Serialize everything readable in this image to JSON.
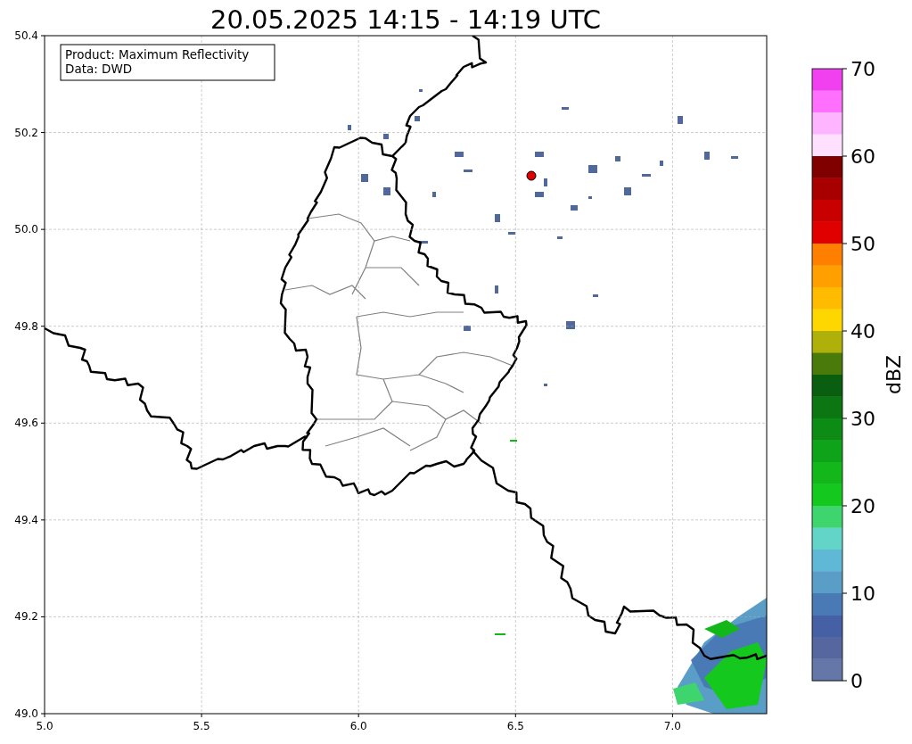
{
  "title": "20.05.2025 14:15 - 14:19 UTC",
  "map": {
    "xticks": [
      "5.0",
      "5.5",
      "6.0",
      "6.5",
      "7.0"
    ],
    "yticks": [
      "50.4",
      "50.2",
      "50.0",
      "49.8",
      "49.6",
      "49.4",
      "49.2",
      "49.0"
    ],
    "legend": [
      "Product: Maximum Reflectivity",
      "Data: DWD"
    ]
  },
  "colorbar": {
    "label": "dBZ",
    "ticks": [
      "70",
      "60",
      "50",
      "40",
      "30",
      "20",
      "10",
      "0"
    ],
    "segments": [
      {
        "color": "#f040f0"
      },
      {
        "color": "#ff70ff"
      },
      {
        "color": "#ffb4ff"
      },
      {
        "color": "#ffe0ff"
      },
      {
        "color": "#800000"
      },
      {
        "color": "#a80000"
      },
      {
        "color": "#c80000"
      },
      {
        "color": "#e00000"
      },
      {
        "color": "#ff7f00"
      },
      {
        "color": "#ffa000"
      },
      {
        "color": "#ffbb00"
      },
      {
        "color": "#ffd700"
      },
      {
        "color": "#b0b00a"
      },
      {
        "color": "#4a7a0a"
      },
      {
        "color": "#0a5e10"
      },
      {
        "color": "#0b7612"
      },
      {
        "color": "#0c8c14"
      },
      {
        "color": "#0fa319"
      },
      {
        "color": "#13b71a"
      },
      {
        "color": "#14c81e"
      },
      {
        "color": "#3ed46e"
      },
      {
        "color": "#62d4c8"
      },
      {
        "color": "#5fb8d5"
      },
      {
        "color": "#5a9ec8"
      },
      {
        "color": "#4a7ab5"
      },
      {
        "color": "#4660a5"
      },
      {
        "color": "#5667a0"
      },
      {
        "color": "#6577a8"
      }
    ]
  }
}
